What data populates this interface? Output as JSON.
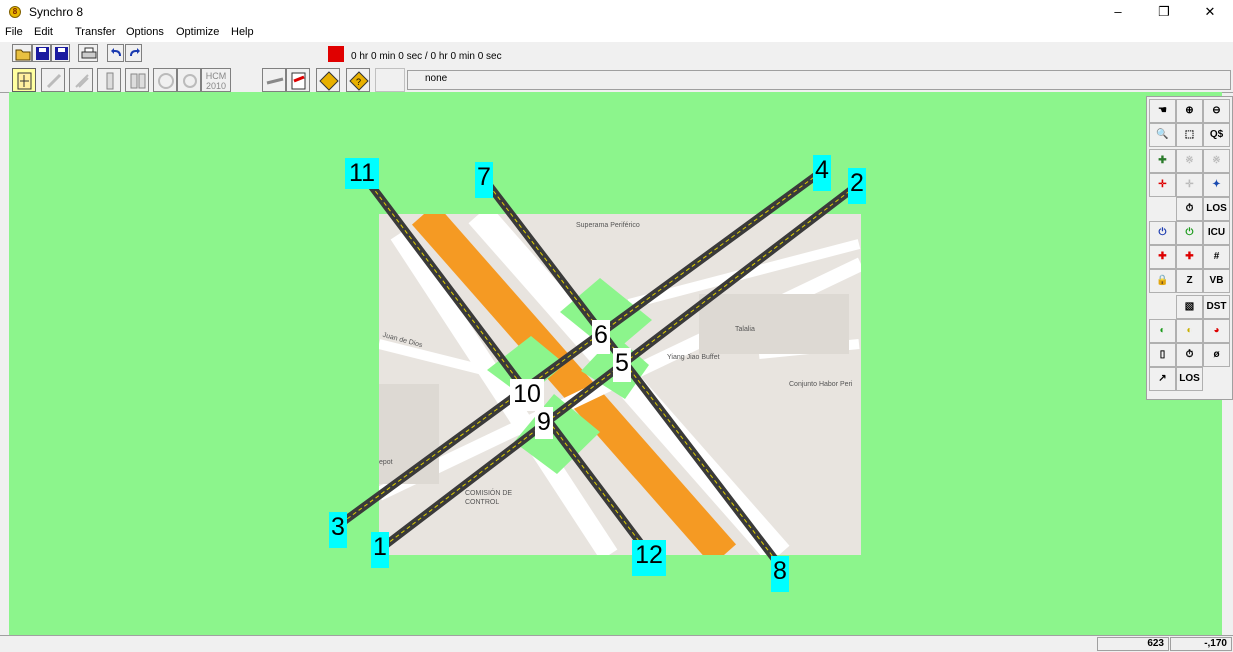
{
  "window": {
    "title": "Synchro 8",
    "app_icon_glyph": "8",
    "minimize": "–",
    "restore": "❐",
    "close": "✕"
  },
  "menu": [
    "File",
    "Edit",
    "Transfer",
    "Options",
    "Optimize",
    "Help"
  ],
  "toolbar": {
    "time_text": "0 hr  0 min  0 sec /  0 hr  0 min  0 sec",
    "hcm_label_1": "HCM",
    "hcm_label_2": "2010",
    "selection_value": "none"
  },
  "map": {
    "labels": {
      "superama": "Superama Periférico",
      "talalia": "Talalia",
      "juan_de_dios": "Juan de Dios",
      "yiang_jiao": "Yiang Jiao Buffet",
      "conjunto": "Conjunto Habor Peri",
      "comision": "COMISIÓN DE",
      "control": "CONTROL",
      "depot": "epot"
    },
    "node_labels": {
      "n1": "1",
      "n2": "2",
      "n3": "3",
      "n4": "4",
      "n5": "5",
      "n6": "6",
      "n7": "7",
      "n8": "8",
      "n9": "9",
      "n10": "10",
      "n11": "11",
      "n12": "12"
    }
  },
  "right_panel": {
    "los_1": "LOS",
    "icu": "ICU",
    "vb": "VB",
    "dst": "DST",
    "phi": "ø",
    "los_2": "LOS"
  },
  "status": {
    "x": "623",
    "y": "-,170"
  },
  "colors": {
    "canvas_bg": "#8cf58c",
    "node_cyan": "#00ffff",
    "road": "#3a3a3a",
    "road_center": "#e0d000",
    "median_orange": "#f59a23"
  }
}
